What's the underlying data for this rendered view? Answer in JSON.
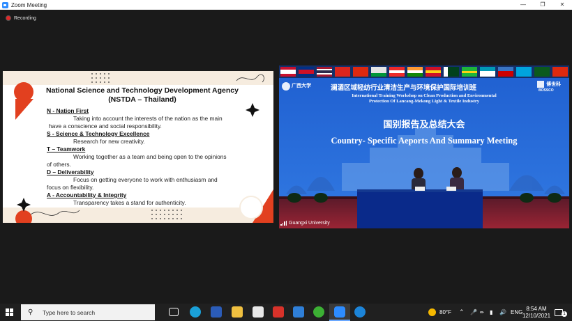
{
  "window": {
    "title": "Zoom Meeting",
    "controls": {
      "minimize": "—",
      "restore": "❐",
      "close": "✕"
    }
  },
  "recording": {
    "label": "Recording"
  },
  "slide": {
    "title_line1": "National Science and Technology Development Agency",
    "title_line2": "(NSTDA – Thailand)",
    "values": [
      {
        "heading": "N - Nation First",
        "text": "Taking into account the interests of the nation as the main",
        "text2": "have a conscience and social responsibility."
      },
      {
        "heading": "S - Science & Technology Excellence",
        "text": "Research for new creativity.",
        "text2": ""
      },
      {
        "heading": "T – Teamwork",
        "text": "Working together as a team and being open to the opinions",
        "text2": "of others."
      },
      {
        "heading": "D – Deliverability",
        "text": "Focus on getting everyone to work with enthusiasm and",
        "text2": "focus on flexibility."
      },
      {
        "heading": "A - Accountability & Integrity",
        "text": "Transparency takes a stand for authenticity.",
        "text2": ""
      }
    ]
  },
  "video": {
    "participant_name": "Guangxi University",
    "banner_cn_title": "澜湄区域轻纺行业清洁生产与环境保护国际培训班",
    "banner_en_title_line1": "International Training Workshop on Clean Production and Environmental",
    "banner_en_title_line2": "Protection Of Lancang-Mekong  Light & Textile Industry",
    "banner_cn_subtitle": "国别报告及总结大会",
    "banner_en_subtitle": "Country- Specific Aeports And Summary Meeting",
    "left_logo_text": "广西大学",
    "right_logo_text": "博世科",
    "right_logo_sub": "BOSSCO",
    "colors": {
      "banner": "#1e55c8",
      "carpet": "#8a1c2c",
      "table": "#0a2a8a"
    }
  },
  "taskbar": {
    "search_placeholder": "Type here to search",
    "weather": "80°F",
    "language": "ENG",
    "time": "8:54 AM",
    "date": "12/10/2021",
    "notification_count": "1",
    "icons": [
      "task-view-icon",
      "edge-icon",
      "word-icon",
      "file-explorer-icon",
      "store-icon",
      "acrobat-icon",
      "mail-icon",
      "wechat-icon",
      "zoom-icon",
      "app-icon"
    ]
  }
}
